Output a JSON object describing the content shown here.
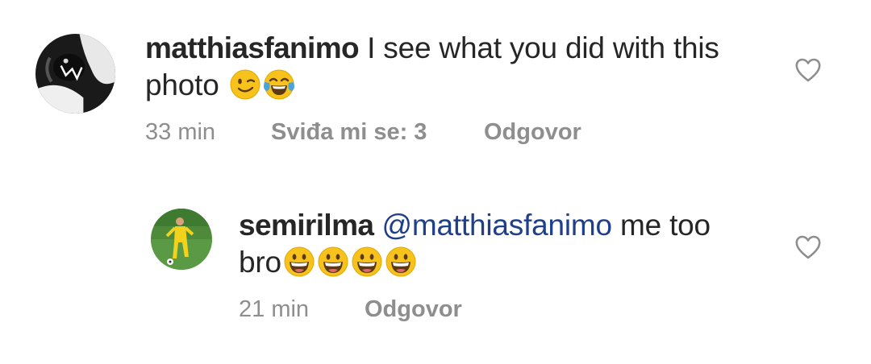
{
  "comments": [
    {
      "username": "matthiasfanimo",
      "text_line1": "I see what you did with this",
      "text_line2": "photo",
      "emojis": [
        "winking-face-emoji",
        "tears-of-joy-emoji"
      ],
      "time": "33 min",
      "likes": "Sviđa mi se: 3",
      "reply": "Odgovor",
      "like_icon": "heart-outline-icon"
    },
    {
      "username": "semirilma",
      "mention": "@matthiasfanimo",
      "text_line1": "me too",
      "text_line2": "bro",
      "emojis": [
        "grinning-face-emoji",
        "grinning-face-emoji",
        "grinning-face-emoji",
        "grinning-face-emoji"
      ],
      "time": "21 min",
      "reply": "Odgovor",
      "like_icon": "heart-outline-icon"
    }
  ],
  "colors": {
    "text": "#262626",
    "meta": "#8e8e8e",
    "mention": "#1f3f8a",
    "emoji_yellow": "#f7c21c"
  }
}
